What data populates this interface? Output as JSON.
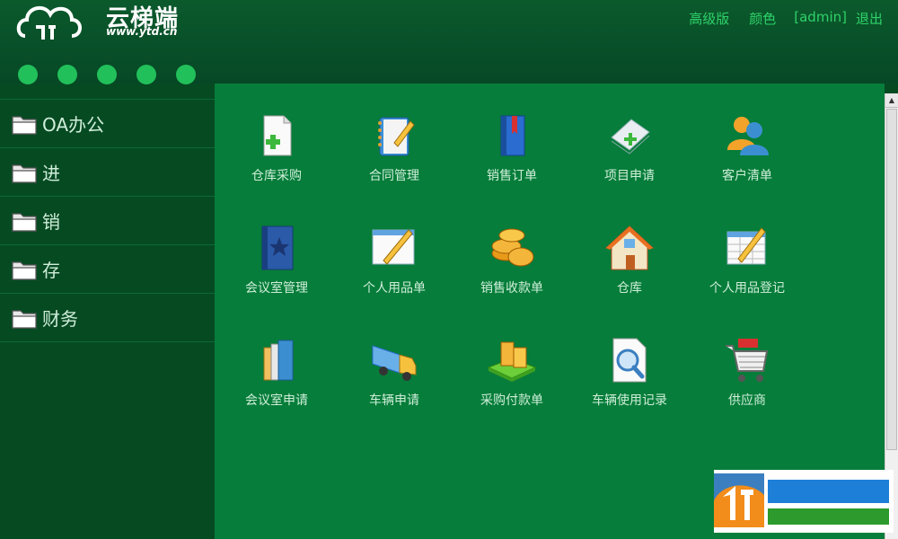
{
  "header": {
    "logo_text": "云梯端",
    "logo_url": "www.ytd.cn",
    "nav": {
      "advanced": "高级版",
      "color": "颜色",
      "user": "[admin]",
      "logout": "退出"
    }
  },
  "sidebar": {
    "items": [
      {
        "label": "OA办公",
        "icon": "folder-icon"
      },
      {
        "label": "进",
        "icon": "folder-icon"
      },
      {
        "label": "销",
        "icon": "folder-icon"
      },
      {
        "label": "存",
        "icon": "folder-icon"
      },
      {
        "label": "财务",
        "icon": "folder-icon"
      }
    ]
  },
  "tiles": [
    {
      "label": "仓库采购",
      "icon": "document-add-icon"
    },
    {
      "label": "合同管理",
      "icon": "notebook-pencil-icon"
    },
    {
      "label": "销售订单",
      "icon": "book-icon"
    },
    {
      "label": "项目申请",
      "icon": "paper-add-icon"
    },
    {
      "label": "客户清单",
      "icon": "users-icon"
    },
    {
      "label": "会议室管理",
      "icon": "star-book-icon"
    },
    {
      "label": "个人用品单",
      "icon": "window-pencil-icon"
    },
    {
      "label": "销售收款单",
      "icon": "coins-icon"
    },
    {
      "label": "仓库",
      "icon": "house-icon"
    },
    {
      "label": "个人用品登记",
      "icon": "spreadsheet-pencil-icon"
    },
    {
      "label": "会议室申请",
      "icon": "binders-icon"
    },
    {
      "label": "车辆申请",
      "icon": "truck-icon"
    },
    {
      "label": "采购付款单",
      "icon": "money-stack-icon"
    },
    {
      "label": "车辆使用记录",
      "icon": "magnifier-document-icon"
    },
    {
      "label": "供应商",
      "icon": "shopping-cart-icon"
    }
  ],
  "colors": {
    "header_bg": "#0b5a2c",
    "sidebar_bg": "#064a22",
    "main_bg": "#067d3a",
    "accent": "#22c05a"
  }
}
